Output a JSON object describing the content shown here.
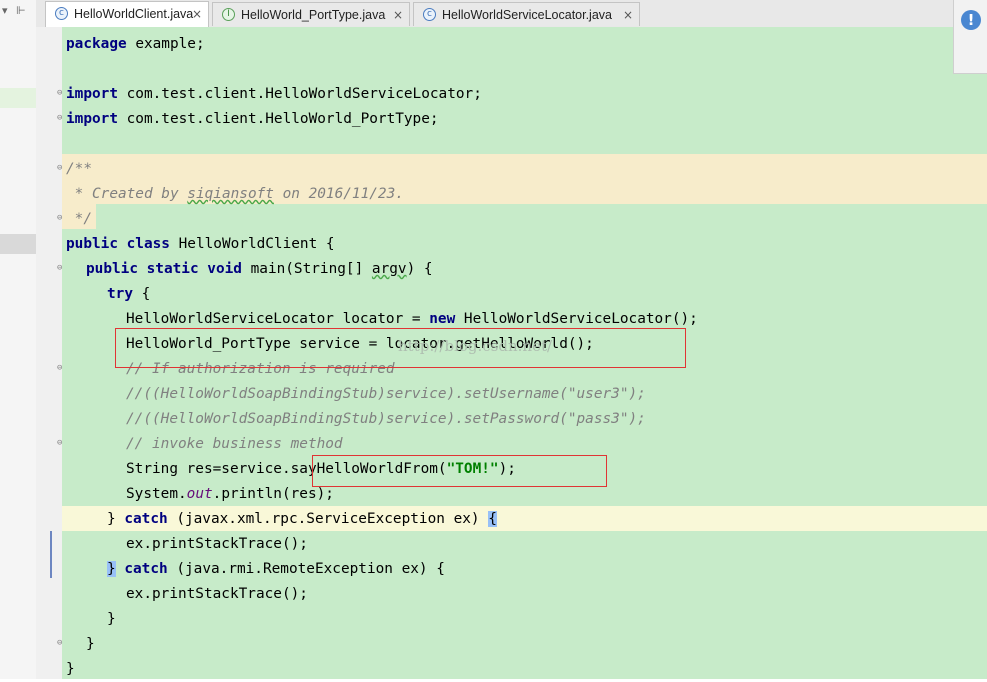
{
  "left_strip": {
    "collapse_glyph": "▾",
    "pin_glyph": "⊩"
  },
  "tabs": [
    {
      "label": "HelloWorldClient.java",
      "icon": "class-icon",
      "icon_glyph": "c",
      "close": "×"
    },
    {
      "label": "HelloWorld_PortType.java",
      "icon": "interface-icon",
      "icon_glyph": "I",
      "close": "×"
    },
    {
      "label": "HelloWorldServiceLocator.java",
      "icon": "class-icon",
      "icon_glyph": "c",
      "close": "×"
    }
  ],
  "notification_icon": "!",
  "watermark": "http://blog.csdn.net/",
  "code": {
    "l1_kw": "package",
    "l1_rest": " example;",
    "l3_kw": "import",
    "l3_rest": " com.test.client.HelloWorldServiceLocator;",
    "l4_kw": "import",
    "l4_rest": " com.test.client.HelloWorld_PortType;",
    "l6": "/**",
    "l7_a": " * Created by ",
    "l7_b": "siqiansoft",
    "l7_c": " on 2016/11/23.",
    "l8": " */",
    "l9_kw": "public class",
    "l9_rest": " HelloWorldClient {",
    "l10_kw": "public static void",
    "l10_rest": " main(String[] ",
    "l10_arg": "argv",
    "l10_end": ") {",
    "l11_kw": "try",
    "l11_rest": " {",
    "l12_a": "HelloWorldServiceLocator locator = ",
    "l12_kw": "new",
    "l12_b": " HelloWorldServiceLocator();",
    "l13": "HelloWorld_PortType service = locator.getHelloWorld();",
    "l14": "// If authorization is required",
    "l15": "//((HelloWorldSoapBindingStub)service).setUsername(\"user3\");",
    "l16": "//((HelloWorldSoapBindingStub)service).setPassword(\"pass3\");",
    "l17": "// invoke business method",
    "l18_a": "String res=service.sayHelloWorldFrom(",
    "l18_str": "\"TOM!\"",
    "l18_b": ");",
    "l19_a": "System.",
    "l19_it": "out",
    "l19_b": ".println(res);",
    "l20_a": "} ",
    "l20_kw": "catch",
    "l20_b": " (javax.xml.rpc.ServiceException ex) ",
    "l20_brace": "{",
    "l21": "ex.printStackTrace();",
    "l22_brace": "}",
    "l22_kw": "catch",
    "l22_b": " (java.rmi.RemoteException ex) {",
    "l23": "ex.printStackTrace();",
    "l24": "}",
    "l25": "}",
    "l26": "}"
  }
}
